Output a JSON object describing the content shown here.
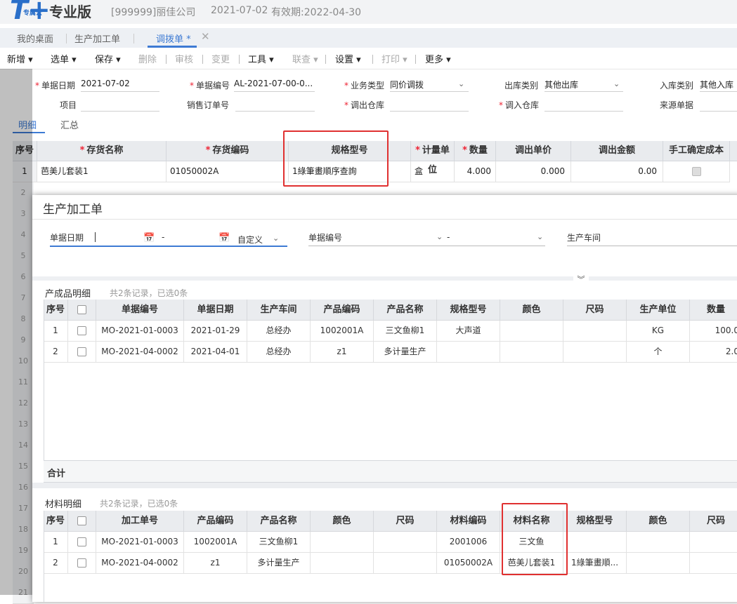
{
  "header": {
    "logo_mark": "T+",
    "logo_sub": "专属云",
    "edition": "专业版",
    "company": "[999999]丽佳公司",
    "date": "2021-07-02",
    "expiry": "有效期:2022-04-30"
  },
  "tabs": [
    {
      "label": "我的桌面"
    },
    {
      "label": "生产加工单"
    },
    {
      "label": "调拨单 *"
    }
  ],
  "toolbar": {
    "items": [
      "新增",
      "选单",
      "保存",
      "删除",
      "审核",
      "变更",
      "工具",
      "联查",
      "设置",
      "打印",
      "更多"
    ]
  },
  "form": {
    "doc_date_label": "单据日期",
    "doc_date": "2021-07-02",
    "doc_no_label": "单据编号",
    "doc_no": "AL-2021-07-00-0...",
    "biz_type_label": "业务类型",
    "biz_type": "同价调拨",
    "out_type_label": "出库类别",
    "out_type": "其他出库",
    "in_type_label": "入库类别",
    "in_type": "其他入库",
    "project_label": "项目",
    "sales_order_label": "销售订单号",
    "out_wh_label": "调出仓库",
    "in_wh_label": "调入仓库",
    "source_label": "来源单据"
  },
  "subtabs": {
    "detail": "明细",
    "summary": "汇总"
  },
  "main_grid": {
    "headers": [
      "序号",
      "存货名称",
      "存货编码",
      "规格型号",
      "计量单位",
      "数量",
      "调出单价",
      "调出金额",
      "手工确定成本"
    ],
    "row": {
      "no": "1",
      "name": "芭美儿套装1",
      "code": "01050002A",
      "spec": "1綠筆畫順序查詢",
      "unit": "盒",
      "qty": "4.000",
      "price": "0.000",
      "amount": "0.00"
    }
  },
  "row_numbers": [
    "2",
    "3",
    "4",
    "5",
    "6",
    "7",
    "8",
    "9",
    "10",
    "11",
    "12",
    "13",
    "14",
    "15",
    "16",
    "17",
    "18",
    "19",
    "20",
    "21"
  ],
  "modal": {
    "title": "生产加工单",
    "filters": {
      "date_label": "单据日期",
      "dash": "-",
      "custom_label": "自定义",
      "doc_no_label": "单据编号",
      "workshop_label": "生产车间"
    },
    "products": {
      "title": "产成品明细",
      "count": "共2条记录，已选0条",
      "headers": [
        "序号",
        "",
        "单据编号",
        "单据日期",
        "生产车间",
        "产品编码",
        "产品名称",
        "规格型号",
        "颜色",
        "尺码",
        "生产单位",
        "数量"
      ],
      "rows": [
        [
          "1",
          "",
          "MO-2021-01-0003",
          "2021-01-29",
          "总经办",
          "1002001A",
          "三文鱼柳1",
          "大声道",
          "",
          "",
          "KG",
          "100.0"
        ],
        [
          "2",
          "",
          "MO-2021-04-0002",
          "2021-04-01",
          "总经办",
          "z1",
          "多计量生产",
          "",
          "",
          "",
          "个",
          "2.0"
        ]
      ],
      "sum_label": "合计"
    },
    "materials": {
      "title": "材料明细",
      "count": "共2条记录，已选0条",
      "headers": [
        "序号",
        "",
        "加工单号",
        "产品编码",
        "产品名称",
        "颜色",
        "尺码",
        "材料编码",
        "材料名称",
        "规格型号",
        "颜色",
        "尺码"
      ],
      "rows": [
        [
          "1",
          "",
          "MO-2021-01-0003",
          "1002001A",
          "三文鱼柳1",
          "",
          "",
          "2001006",
          "三文鱼",
          "",
          "",
          ""
        ],
        [
          "2",
          "",
          "MO-2021-04-0002",
          "z1",
          "多计量生产",
          "",
          "",
          "01050002A",
          "芭美儿套装1",
          "1綠筆畫順...",
          "",
          ""
        ]
      ]
    }
  }
}
